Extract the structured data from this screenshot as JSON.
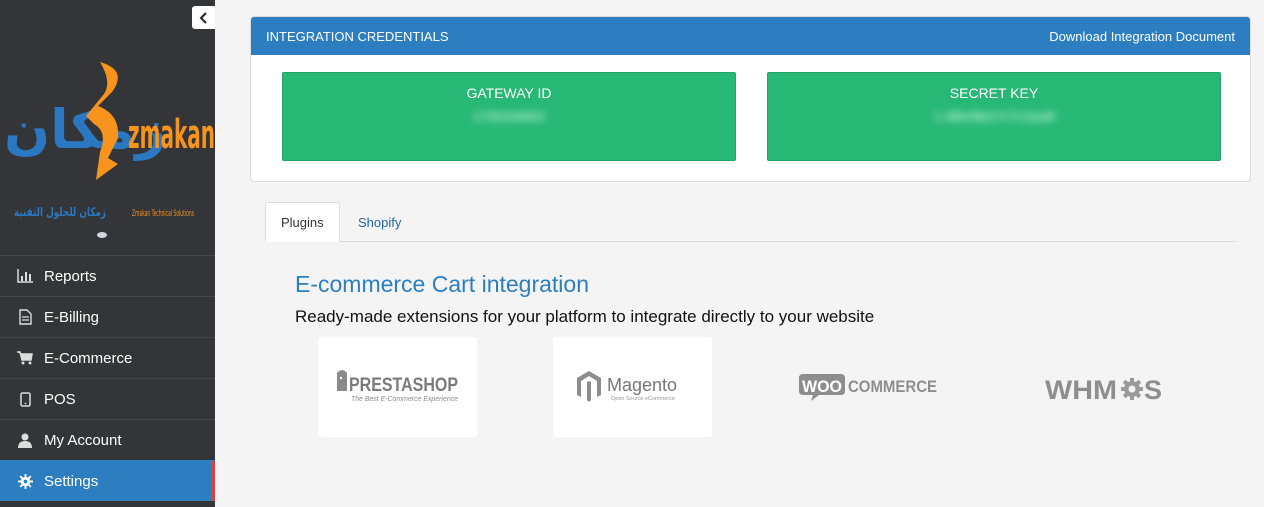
{
  "sidebar": {
    "logo": {
      "arabic_text": "زمكان",
      "latin_text": "zmakan",
      "arabic_tagline": "زمكان للحلول التقنية",
      "latin_tagline": "Zmakan Technical Solutions"
    },
    "items": [
      {
        "label": "Reports",
        "icon": "bar-chart-icon"
      },
      {
        "label": "E-Billing",
        "icon": "document-icon"
      },
      {
        "label": "E-Commerce",
        "icon": "cart-icon"
      },
      {
        "label": "POS",
        "icon": "tablet-icon"
      },
      {
        "label": "My Account",
        "icon": "user-icon"
      },
      {
        "label": "Settings",
        "icon": "gear-icon",
        "active": true
      }
    ]
  },
  "credentials": {
    "title": "INTEGRATION CREDENTIALS",
    "download_link": "Download Integration Document",
    "gateway_label": "GATEWAY ID",
    "gateway_value": "1730249902",
    "secret_label": "SECRET KEY",
    "secret_value": "1-3f8cf9b27c7c1ba9f"
  },
  "tabs": [
    {
      "label": "Plugins",
      "active": true
    },
    {
      "label": "Shopify",
      "active": false
    }
  ],
  "integration": {
    "title": "E-commerce Cart integration",
    "subtitle": "Ready-made extensions for your platform to integrate directly to your website"
  },
  "plugins": {
    "prestashop": {
      "name": "PRESTASHOP",
      "tagline": "The Best E-Commerce Experience"
    },
    "magento": {
      "name": "Magento",
      "tagline": "Open Source eCommerce"
    },
    "woocommerce": {
      "name_woo": "WOO",
      "name_commerce": "COMMERCE"
    },
    "whmcs": {
      "name_pre": "WHM",
      "name_post": "S"
    }
  },
  "colors": {
    "sidebar_bg": "#333538",
    "accent_blue": "#2c7ec1",
    "credential_green": "#27b876",
    "active_marker": "#d9453a",
    "logo_orange": "#f7941d",
    "logo_blue": "#2a78c2"
  }
}
